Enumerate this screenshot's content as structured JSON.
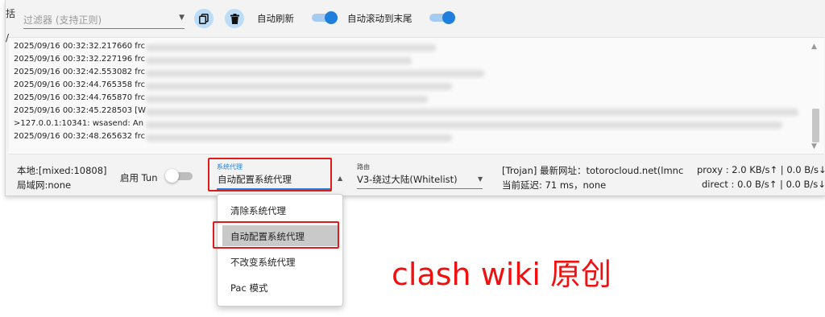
{
  "toolbar": {
    "filter_placeholder": "过滤器 (支持正则)",
    "auto_refresh_label": "自动刷新",
    "auto_refresh_on": true,
    "auto_scroll_label": "自动滚动到末尾",
    "auto_scroll_on": true
  },
  "log": {
    "lines": [
      "2025/09/16 00:32:32.217660 frc",
      "2025/09/16 00:32:32.227196 frc",
      "2025/09/16 00:32:42.553082 frc",
      "2025/09/16 00:32:44.765358 frc",
      "2025/09/16 00:32:44.765870 frc",
      "2025/09/16 00:32:45.228503 [W",
      ">127.0.0.1:10341: wsasend: An",
      "2025/09/16 00:32:48.265632 frc"
    ]
  },
  "status": {
    "local_port": "本地:[mixed:10808]",
    "lan": "局域网:none",
    "tun_label": "启用 Tun",
    "tun_on": false,
    "system_proxy_caption": "系统代理",
    "system_proxy_value": "自动配置系统代理",
    "routing_caption": "路由",
    "routing_value": "V3-绕过大陆(Whitelist)",
    "server_info": "[Trojan] 最新网址：totorocloud.net(lmnc",
    "latency": "当前延迟: 71 ms，none",
    "proxy_speed": "proxy : 2.0 KB/s↑ | 0.0 B/s↓",
    "direct_speed": "direct : 0.0 B/s↑ | 0.0 B/s↓"
  },
  "menu": {
    "items": [
      {
        "label": "清除系统代理"
      },
      {
        "label": "自动配置系统代理"
      },
      {
        "label": "不改变系统代理"
      },
      {
        "label": "Pac 模式"
      }
    ],
    "selected_index": 1
  },
  "watermark": "clash wiki 原创",
  "colors": {
    "accent": "#1e7fdc",
    "highlight_box": "#e01b1b",
    "watermark": "#f01010"
  },
  "icons": {
    "copy": "copy-icon",
    "delete": "trash-icon"
  }
}
